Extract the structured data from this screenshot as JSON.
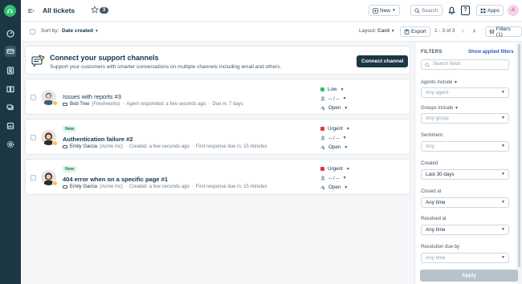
{
  "header": {
    "title": "All tickets",
    "ticket_count": "3",
    "new_label": "New",
    "search_label": "Search",
    "help_label": "?",
    "apps_label": "Apps",
    "avatar_initial": "A"
  },
  "toolbar": {
    "sort_by_label": "Sort by:",
    "sort_by_value": "Date created",
    "layout_label": "Layout:",
    "layout_value": "Card",
    "export_label": "Export",
    "pagination": "1 - 3 of 3",
    "filters_label": "Filters (1)"
  },
  "banner": {
    "title": "Connect your support channels",
    "subtitle": "Support your customers with smarter conversations on multiple channels including email and others.",
    "button_label": "Connect channel"
  },
  "tickets": [
    {
      "is_new": false,
      "new_label": "",
      "title": "Issues with reports #3",
      "requester": "Bob Tree",
      "company": "(Freshworks)",
      "meta1": "Agent responded: a few seconds ago",
      "meta2": "Due in: 7 days",
      "priority": "Low",
      "priority_color": "#2fbf71",
      "agent": "-- / --",
      "status": "Open"
    },
    {
      "is_new": true,
      "new_label": "New",
      "title": "Authentication failure #2",
      "requester": "Emily Garcia",
      "company": "(Acme Inc)",
      "meta1": "Created: a few seconds ago",
      "meta2": "First response due in: 15 minutes",
      "priority": "Urgent",
      "priority_color": "#e43538",
      "agent": "-- / --",
      "status": "Open"
    },
    {
      "is_new": true,
      "new_label": "New",
      "title": "404 error when on a specific page #1",
      "requester": "Emily Garcia",
      "company": "(Acme Inc)",
      "meta1": "Created: a few seconds ago",
      "meta2": "First response due in: 15 minutes",
      "priority": "Urgent",
      "priority_color": "#e43538",
      "agent": "-- / --",
      "status": "Open"
    }
  ],
  "filters": {
    "heading": "FILTERS",
    "show_applied": "Show applied filters",
    "search_placeholder": "Search fields",
    "fields": [
      {
        "label": "Agents include",
        "value": "Any agent",
        "placeholder": true
      },
      {
        "label": "Groups include",
        "value": "Any group",
        "placeholder": true
      },
      {
        "label": "Sentiment",
        "value": "Any",
        "placeholder": true
      },
      {
        "label": "Created",
        "value": "Last 30 days",
        "placeholder": false
      },
      {
        "label": "Closed at",
        "value": "Any time",
        "placeholder": false
      },
      {
        "label": "Resolved at",
        "value": "Any time",
        "placeholder": false
      },
      {
        "label": "Resolution due by",
        "value": "Any time",
        "placeholder": true
      }
    ],
    "apply_label": "Apply"
  }
}
